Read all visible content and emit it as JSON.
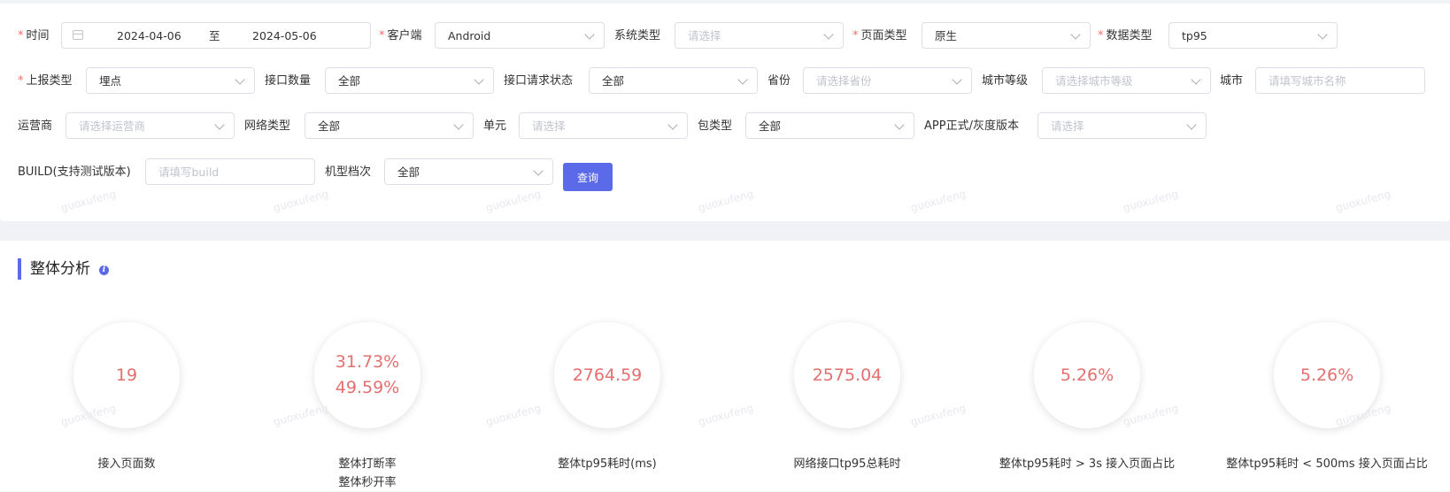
{
  "filters": {
    "time": {
      "label": "时间",
      "start": "2024-04-06",
      "sep": "至",
      "end": "2024-05-06"
    },
    "client": {
      "label": "客户端",
      "value": "Android"
    },
    "system_type": {
      "label": "系统类型",
      "placeholder": "请选择"
    },
    "page_type": {
      "label": "页面类型",
      "value": "原生"
    },
    "data_type": {
      "label": "数据类型",
      "value": "tp95"
    },
    "report_type": {
      "label": "上报类型",
      "value": "埋点"
    },
    "api_count": {
      "label": "接口数量",
      "value": "全部"
    },
    "api_status": {
      "label": "接口请求状态",
      "value": "全部"
    },
    "province": {
      "label": "省份",
      "placeholder": "请选择省份"
    },
    "city_level": {
      "label": "城市等级",
      "placeholder": "请选择城市等级"
    },
    "city": {
      "label": "城市",
      "placeholder": "请填写城市名称"
    },
    "carrier": {
      "label": "运营商",
      "placeholder": "请选择运营商"
    },
    "network_type": {
      "label": "网络类型",
      "value": "全部"
    },
    "unit": {
      "label": "单元",
      "placeholder": "请选择"
    },
    "package_type": {
      "label": "包类型",
      "value": "全部"
    },
    "app_version": {
      "label": "APP正式/灰度版本",
      "placeholder": "请选择"
    },
    "build": {
      "label": "BUILD(支持测试版本)",
      "placeholder": "请填写build"
    },
    "device_tier": {
      "label": "机型档次",
      "value": "全部"
    },
    "query_button": "查询"
  },
  "analysis": {
    "title": "整体分析",
    "info_icon": "i",
    "metrics": [
      {
        "values": [
          "19"
        ],
        "captions": [
          "接入页面数"
        ]
      },
      {
        "values": [
          "31.73%",
          "49.59%"
        ],
        "captions": [
          "整体打断率",
          "整体秒开率"
        ]
      },
      {
        "values": [
          "2764.59"
        ],
        "captions": [
          "整体tp95耗时(ms)"
        ]
      },
      {
        "values": [
          "2575.04"
        ],
        "captions": [
          "网络接口tp95总耗时"
        ]
      },
      {
        "values": [
          "5.26%"
        ],
        "captions": [
          "整体tp95耗时 > 3s 接入页面占比"
        ]
      },
      {
        "values": [
          "5.26%"
        ],
        "captions": [
          "整体tp95耗时 < 500ms 接入页面占比"
        ]
      }
    ]
  },
  "watermark": "guoxufeng",
  "colors": {
    "accent": "#5b6ae8",
    "metric_value": "#e36f6f",
    "required": "#f56c6c"
  }
}
